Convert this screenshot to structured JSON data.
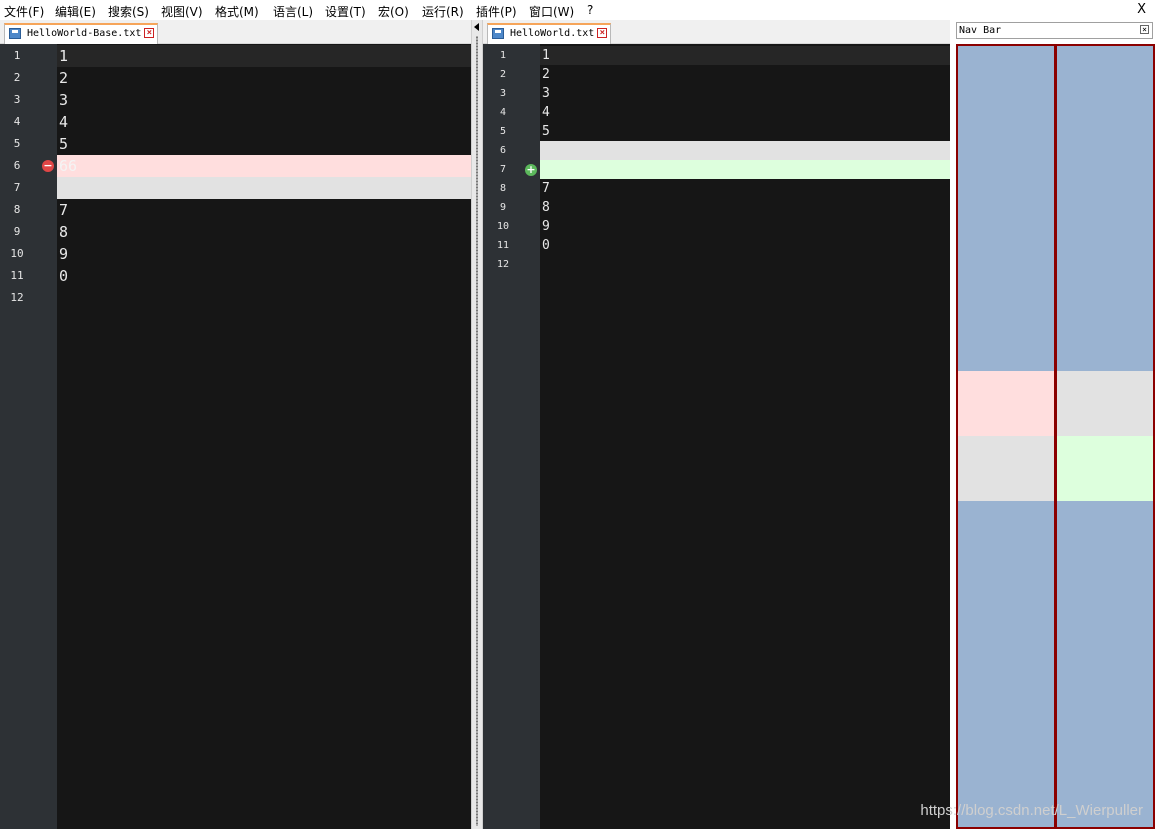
{
  "menu": [
    "文件(F)",
    "编辑(E)",
    "搜索(S)",
    "视图(V)",
    "格式(M)",
    "语言(L)",
    "设置(T)",
    "宏(O)",
    "运行(R)",
    "插件(P)",
    "窗口(W)",
    "?"
  ],
  "window_close_label": "X",
  "left_pane": {
    "tab_label": "HelloWorld-Base.txt",
    "tab_close_glyph": "×",
    "lines": [
      {
        "num": "1",
        "text": "1",
        "state": "current"
      },
      {
        "num": "2",
        "text": "2",
        "state": "normal"
      },
      {
        "num": "3",
        "text": "3",
        "state": "normal"
      },
      {
        "num": "4",
        "text": "4",
        "state": "normal"
      },
      {
        "num": "5",
        "text": "5",
        "state": "normal"
      },
      {
        "num": "6",
        "text": "66",
        "state": "removed",
        "marker": "minus-icon"
      },
      {
        "num": "7",
        "text": "",
        "state": "blank"
      },
      {
        "num": "8",
        "text": "7",
        "state": "normal"
      },
      {
        "num": "9",
        "text": "8",
        "state": "normal"
      },
      {
        "num": "10",
        "text": "9",
        "state": "normal"
      },
      {
        "num": "11",
        "text": "0",
        "state": "normal"
      },
      {
        "num": "12",
        "text": "",
        "state": "normal"
      }
    ]
  },
  "right_pane": {
    "tab_label": "HelloWorld.txt",
    "tab_close_glyph": "×",
    "lines": [
      {
        "num": "1",
        "text": "1",
        "state": "current"
      },
      {
        "num": "2",
        "text": "2",
        "state": "normal"
      },
      {
        "num": "3",
        "text": "3",
        "state": "normal"
      },
      {
        "num": "4",
        "text": "4",
        "state": "normal"
      },
      {
        "num": "5",
        "text": "5",
        "state": "normal"
      },
      {
        "num": "6",
        "text": "",
        "state": "blank"
      },
      {
        "num": "7",
        "text": "",
        "state": "added",
        "marker": "plus-icon"
      },
      {
        "num": "8",
        "text": "7",
        "state": "normal"
      },
      {
        "num": "9",
        "text": "8",
        "state": "normal"
      },
      {
        "num": "10",
        "text": "9",
        "state": "normal"
      },
      {
        "num": "11",
        "text": "0",
        "state": "normal"
      },
      {
        "num": "12",
        "text": "",
        "state": "normal"
      }
    ]
  },
  "nav_bar": {
    "title": "Nav Bar",
    "close_glyph": "×",
    "columns": [
      {
        "segments": [
          {
            "state": "normal",
            "lines": 5
          },
          {
            "state": "removed",
            "lines": 1
          },
          {
            "state": "blank",
            "lines": 1
          },
          {
            "state": "normal",
            "lines": 5
          }
        ]
      },
      {
        "segments": [
          {
            "state": "normal",
            "lines": 5
          },
          {
            "state": "blank",
            "lines": 1
          },
          {
            "state": "added",
            "lines": 1
          },
          {
            "state": "normal",
            "lines": 5
          }
        ]
      }
    ]
  },
  "colors": {
    "removed": "#ffdede",
    "added": "#ddffdd",
    "blank": "#e2e2e2",
    "current": "#262626",
    "nav_normal": "#9ab3d1",
    "removed_marker": "#e04646",
    "added_marker": "#5cb85c"
  },
  "watermark": "https://blog.csdn.net/L_Wierpuller"
}
